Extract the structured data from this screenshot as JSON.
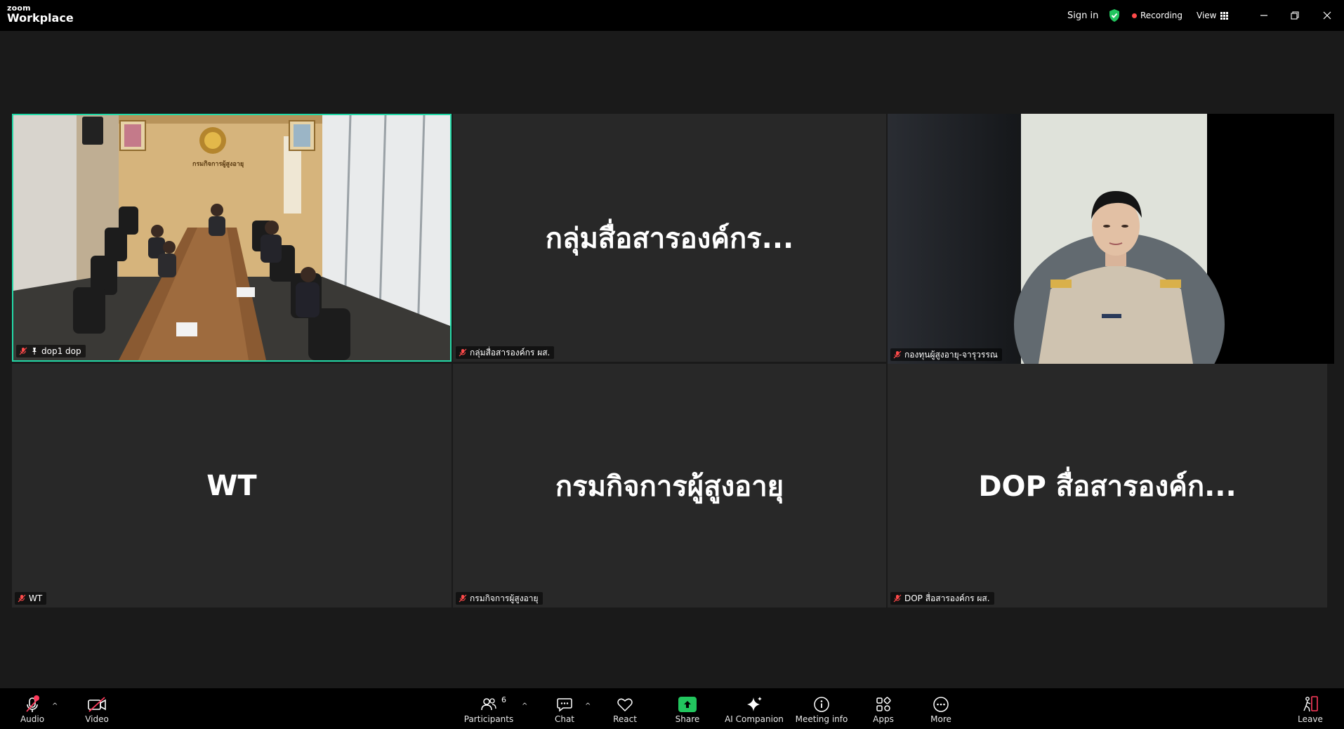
{
  "app": {
    "brand_small": "zoom",
    "brand_large": "Workplace"
  },
  "titlebar": {
    "sign_in": "Sign in",
    "recording": "Recording",
    "view": "View"
  },
  "tiles": [
    {
      "name": "dop1 dop",
      "type": "video",
      "active": true
    },
    {
      "name": "กลุ่มสื่อสารองค์กร ผส.",
      "display": "กลุ่มสื่อสารองค์กร...",
      "type": "name"
    },
    {
      "name": "กองทุนผู้สูงอายุ-จารุวรรณ",
      "type": "video"
    },
    {
      "name": "WT",
      "display": "WT",
      "type": "name"
    },
    {
      "name": "กรมกิจการผู้สูงอายุ",
      "display": "กรมกิจการผู้สูงอายุ",
      "type": "name"
    },
    {
      "name": "DOP สื่อสารองค์กร ผส.",
      "display": "DOP สื่อสารองค์ก...",
      "type": "name"
    }
  ],
  "room_sign": "กรมกิจการผู้สูงอายุ",
  "toolbar": {
    "audio": "Audio",
    "video": "Video",
    "participants": "Participants",
    "participants_count": "6",
    "chat": "Chat",
    "react": "React",
    "share": "Share",
    "ai_companion": "AI Companion",
    "meeting_info": "Meeting info",
    "apps": "Apps",
    "more": "More",
    "leave": "Leave"
  },
  "colors": {
    "active_border": "#23d9a7",
    "recording": "#ff4a4a",
    "share": "#22c55e",
    "alert": "#ff3b5c"
  }
}
